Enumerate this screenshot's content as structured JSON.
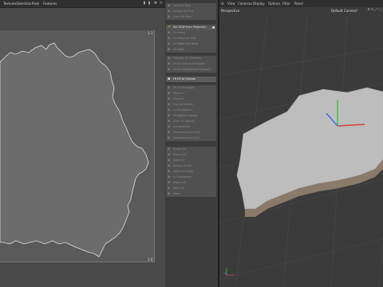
{
  "uv_editor": {
    "menus": [
      "Textures",
      "Selection",
      "Pixel",
      "Features"
    ],
    "tool_icons": [
      "bar-chart-icon",
      "bar-chart-icon",
      "move-icon",
      "refresh-icon"
    ],
    "coord_top": "1.1",
    "coord_bottom": "1.0"
  },
  "commands": {
    "items": [
      {
        "label": "Lock UV Pins",
        "state": "disabled",
        "icon": "gray"
      },
      {
        "label": "Unlock UV Pins",
        "state": "disabled",
        "icon": "gray"
      },
      {
        "label": "Clear UV Pins",
        "state": "disabled",
        "icon": "gray"
      },
      {
        "label": "Set UVW from Projection",
        "state": "active",
        "icon": "orange",
        "dot": true
      },
      {
        "label": "UV Relax",
        "state": "disabled",
        "icon": "gray"
      },
      {
        "label": "UV Mesh on Grid",
        "state": "disabled",
        "icon": "gray"
      },
      {
        "label": "UV Weld and Relax",
        "state": "disabled",
        "icon": "gray"
      },
      {
        "label": "UV Weld",
        "state": "disabled",
        "icon": "gray"
      },
      {
        "label": "Transfer UV Selection",
        "state": "disabled",
        "icon": "gray"
      },
      {
        "label": "Fit UV Islands to Region",
        "state": "disabled",
        "icon": "gray"
      },
      {
        "label": "Show Overlapping Polygons",
        "state": "disabled",
        "icon": "gray"
      },
      {
        "label": "Fit UV to Canvas",
        "state": "highlight",
        "icon": "white"
      },
      {
        "label": "Fit UV to Region",
        "state": "disabled",
        "icon": "gray"
      },
      {
        "label": "Mirror U",
        "state": "disabled",
        "icon": "gray"
      },
      {
        "label": "Mirror V",
        "state": "disabled",
        "icon": "gray"
      },
      {
        "label": "Flip UV Islands",
        "state": "disabled",
        "icon": "gray"
      },
      {
        "label": "UV Straighten",
        "state": "disabled",
        "icon": "gray"
      },
      {
        "label": "Straighten Islands",
        "state": "disabled",
        "icon": "gray"
      },
      {
        "label": "Align UV Islands",
        "state": "disabled",
        "icon": "gray"
      },
      {
        "label": "Combine Pts",
        "state": "disabled",
        "icon": "gray"
      },
      {
        "label": "Distribute to U Grid",
        "state": "disabled",
        "icon": "gray"
      },
      {
        "label": "Distribute to V Grid",
        "state": "disabled",
        "icon": "gray"
      },
      {
        "label": "Break UV",
        "state": "disabled",
        "icon": "gray"
      },
      {
        "label": "Stitch UV",
        "state": "disabled",
        "icon": "gray"
      },
      {
        "label": "Weld UV",
        "state": "disabled",
        "icon": "gray"
      },
      {
        "label": "Attach UV Sel.",
        "state": "disabled",
        "icon": "gray"
      },
      {
        "label": "Stitch UV Edge",
        "state": "disabled",
        "icon": "gray"
      },
      {
        "label": "UV Smoothen",
        "state": "disabled",
        "icon": "gray"
      },
      {
        "label": "Match UV",
        "state": "disabled",
        "icon": "gray"
      },
      {
        "label": "Weld UV",
        "state": "disabled",
        "icon": "gray"
      },
      {
        "label": "Relax",
        "state": "disabled",
        "icon": "gray"
      }
    ]
  },
  "viewport": {
    "menus": [
      "View",
      "Cameras",
      "Display",
      "Options",
      "Filter",
      "Panel"
    ],
    "view_name": "Perspective",
    "camera_name": "Default Camera",
    "camera_marker": "*"
  }
}
